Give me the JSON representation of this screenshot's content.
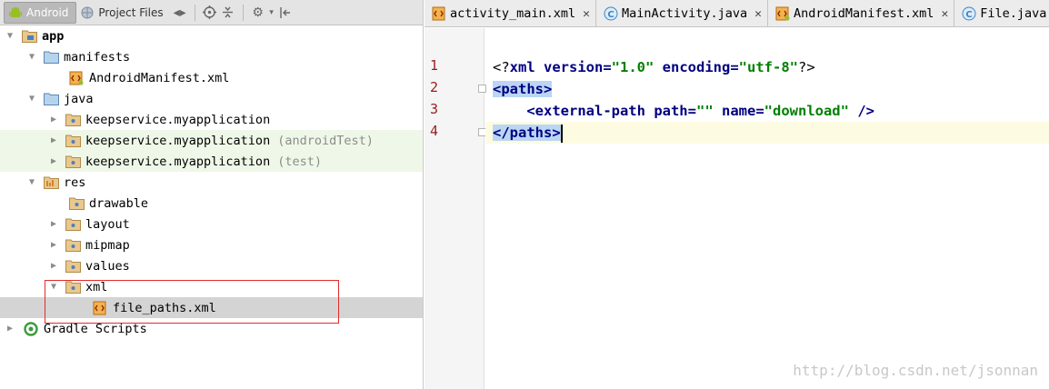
{
  "panel": {
    "tabs": [
      {
        "label": "Android"
      },
      {
        "label": "Project Files"
      }
    ]
  },
  "tree": [
    {
      "label": "app",
      "bold": true
    },
    {
      "label": "manifests"
    },
    {
      "label": "AndroidManifest.xml"
    },
    {
      "label": "java"
    },
    {
      "label": "keepservice.myapplication"
    },
    {
      "label": "keepservice.myapplication",
      "suffix": "(androidTest)"
    },
    {
      "label": "keepservice.myapplication",
      "suffix": "(test)"
    },
    {
      "label": "res"
    },
    {
      "label": "drawable"
    },
    {
      "label": "layout"
    },
    {
      "label": "mipmap"
    },
    {
      "label": "values"
    },
    {
      "label": "xml"
    },
    {
      "label": "file_paths.xml"
    },
    {
      "label": "Gradle Scripts"
    }
  ],
  "editor": {
    "tabs": [
      {
        "label": "activity_main.xml",
        "icon": "xml-file-icon"
      },
      {
        "label": "MainActivity.java",
        "icon": "java-class-icon"
      },
      {
        "label": "AndroidManifest.xml",
        "icon": "manifest-icon"
      },
      {
        "label": "File.java",
        "icon": "java-class-icon"
      }
    ],
    "line_numbers": [
      "1",
      "2",
      "3",
      "4"
    ],
    "code": {
      "l1_open": "<?",
      "l1_kw": "xml",
      "l1_attr1": " version=",
      "l1_val1": "\"1.0\"",
      "l1_attr2": " encoding=",
      "l1_val2": "\"utf-8\"",
      "l1_close": "?>",
      "l2_tag": "<paths>",
      "l3_indent": "    ",
      "l3_open": "<external-path",
      "l3_attr1": " path=",
      "l3_val1": "\"\"",
      "l3_attr2": " name=",
      "l3_val2": "\"download\"",
      "l3_close": " />",
      "l4_tag": "</paths>"
    }
  },
  "watermark": "http://blog.csdn.net/jsonnan",
  "colors": {
    "selection": "#bad6f4",
    "highlight_box": "#e12b2b",
    "test_row": "#eff8e8",
    "keyword": "#000080",
    "string": "#008000"
  }
}
